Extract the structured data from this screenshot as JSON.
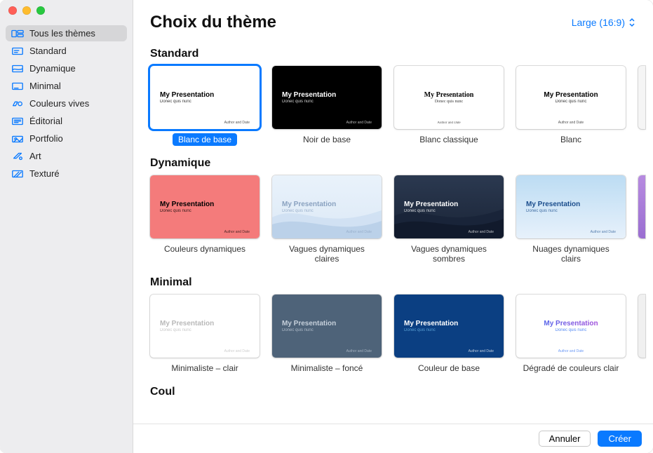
{
  "header": {
    "title": "Choix du thème",
    "aspect_label": "Large (16:9)"
  },
  "sidebar": {
    "items": [
      {
        "label": "Tous les thèmes",
        "selected": true,
        "icon": "all"
      },
      {
        "label": "Standard",
        "selected": false,
        "icon": "standard"
      },
      {
        "label": "Dynamique",
        "selected": false,
        "icon": "dynamic"
      },
      {
        "label": "Minimal",
        "selected": false,
        "icon": "minimal"
      },
      {
        "label": "Couleurs vives",
        "selected": false,
        "icon": "bold"
      },
      {
        "label": "Éditorial",
        "selected": false,
        "icon": "editorial"
      },
      {
        "label": "Portfolio",
        "selected": false,
        "icon": "portfolio"
      },
      {
        "label": "Art",
        "selected": false,
        "icon": "art"
      },
      {
        "label": "Texturé",
        "selected": false,
        "icon": "texture"
      }
    ]
  },
  "sections": [
    {
      "title": "Standard",
      "themes": [
        {
          "label": "Blanc de base",
          "selected": true,
          "bg": "#ffffff",
          "text": "#000000",
          "align": "left"
        },
        {
          "label": "Noir de base",
          "selected": false,
          "bg": "#000000",
          "text": "#ffffff",
          "align": "left"
        },
        {
          "label": "Blanc classique",
          "selected": false,
          "bg": "#ffffff",
          "text": "#000000",
          "font": "serif",
          "align": "center"
        },
        {
          "label": "Blanc",
          "selected": false,
          "bg": "#ffffff",
          "text": "#000000",
          "align": "center"
        }
      ],
      "peek": "#f5f5f5"
    },
    {
      "title": "Dynamique",
      "themes": [
        {
          "label": "Couleurs dynamiques",
          "selected": false,
          "bg": "linear-gradient(#f47b7b,#f47b7b)",
          "text": "#000000",
          "align": "left"
        },
        {
          "label": "Vagues dynamiques claires",
          "selected": false,
          "bg": "linear-gradient(180deg,#e9f2fb 0%,#dce9f6 100%)",
          "text": "#8aa2c0",
          "align": "left",
          "waves": "light"
        },
        {
          "label": "Vagues dynamiques sombres",
          "selected": false,
          "bg": "linear-gradient(180deg,#2b3950 0%,#1a2437 100%)",
          "text": "#ffffff",
          "align": "left",
          "waves": "dark"
        },
        {
          "label": "Nuages dynamiques clairs",
          "selected": false,
          "bg": "linear-gradient(180deg,#bcdcf3 0%,#e7f1fb 100%)",
          "text": "#1b4d8c",
          "align": "left"
        }
      ],
      "peek": "linear-gradient(180deg,#b78be0,#9a6ed1)"
    },
    {
      "title": "Minimal",
      "themes": [
        {
          "label": "Minimaliste – clair",
          "selected": false,
          "bg": "#ffffff",
          "text": "#b9b9b9",
          "align": "left"
        },
        {
          "label": "Minimaliste – foncé",
          "selected": false,
          "bg": "#4e6379",
          "text": "#c6d0db",
          "align": "left"
        },
        {
          "label": "Couleur de base",
          "selected": false,
          "bg": "#0b3f82",
          "text": "#ffffff",
          "sub": "#6db8e8",
          "align": "left"
        },
        {
          "label": "Dégradé de couleurs clair",
          "selected": false,
          "bg": "#ffffff",
          "text_grad": "linear-gradient(90deg,#2e6ff0,#c943d4)",
          "text": "#2e6ff0",
          "align": "center"
        }
      ],
      "peek": "#f0f0f0"
    },
    {
      "title": "Coul",
      "themes": []
    }
  ],
  "preview": {
    "title": "My Presentation",
    "subtitle": "Donec quis nunc",
    "author": "Author and Date"
  },
  "footer": {
    "cancel": "Annuler",
    "create": "Créer"
  }
}
